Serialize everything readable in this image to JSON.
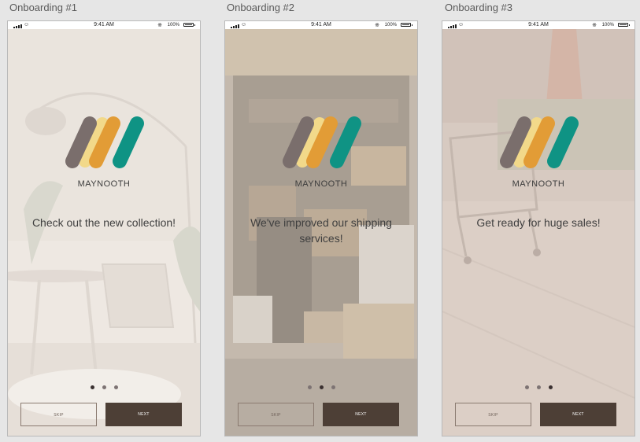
{
  "artboards": [
    {
      "title": "Onboarding #1",
      "headline": "Check out the new collection!",
      "active_dot": 0
    },
    {
      "title": "Onboarding #2",
      "headline": "We've improved our shipping services!",
      "active_dot": 1
    },
    {
      "title": "Onboarding #3",
      "headline": "Get ready for huge sales!",
      "active_dot": 2
    }
  ],
  "status_bar": {
    "time": "9:41 AM",
    "battery": "100%",
    "wifi_icon": "wifi-icon",
    "bluetooth_icon": "bluetooth-icon"
  },
  "brand": "MAYNOOTH",
  "buttons": {
    "skip": "SKIP",
    "next": "NEXT"
  },
  "colors": {
    "logo_gray": "#7a6e6c",
    "logo_orange": "#e29c36",
    "logo_teal": "#0f9384",
    "logo_yellow": "#f2d98a",
    "next_bg": "#4d3f36"
  }
}
